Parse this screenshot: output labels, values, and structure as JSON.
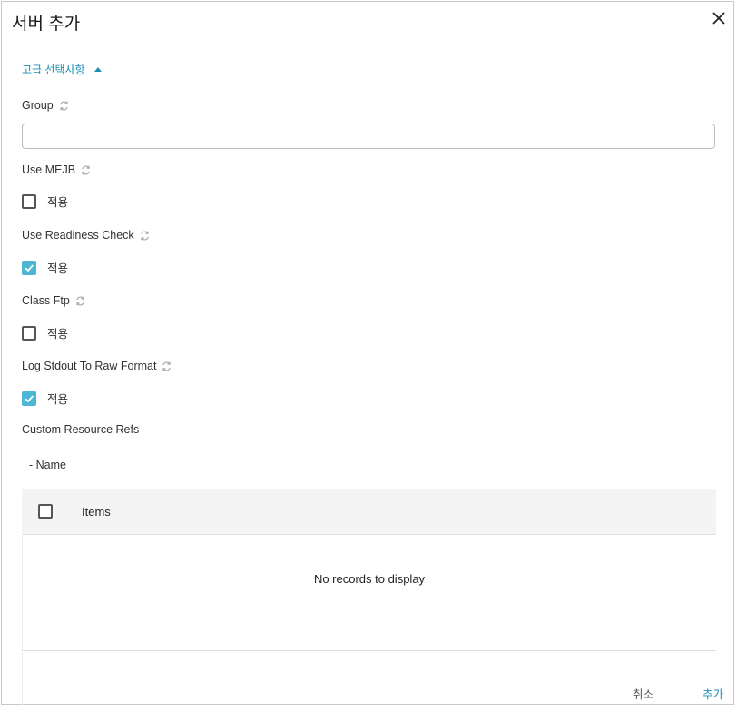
{
  "dialog": {
    "title": "서버 추가",
    "close_icon": "close-icon"
  },
  "advanced": {
    "label": "고급 선택사항",
    "expanded": true,
    "icon": "caret-up-icon"
  },
  "fields": {
    "group": {
      "label": "Group",
      "value": "",
      "placeholder": ""
    },
    "use_mejb": {
      "label": "Use MEJB",
      "option_label": "적용",
      "checked": false
    },
    "use_readiness_check": {
      "label": "Use Readiness Check",
      "option_label": "적용",
      "checked": true
    },
    "class_ftp": {
      "label": "Class Ftp",
      "option_label": "적용",
      "checked": false
    },
    "log_stdout_to_raw_format": {
      "label": "Log Stdout To Raw Format",
      "option_label": "적용",
      "checked": true
    }
  },
  "custom_resource_refs": {
    "label": "Custom Resource Refs",
    "sub_label": "- Name",
    "table": {
      "columns": [
        "Items"
      ],
      "rows": [],
      "empty_text": "No records to display"
    }
  },
  "footer": {
    "cancel_label": "취소",
    "add_label": "추가"
  },
  "colors": {
    "accent": "#1f8fb5",
    "checkbox_checked": "#4cb6d3"
  }
}
